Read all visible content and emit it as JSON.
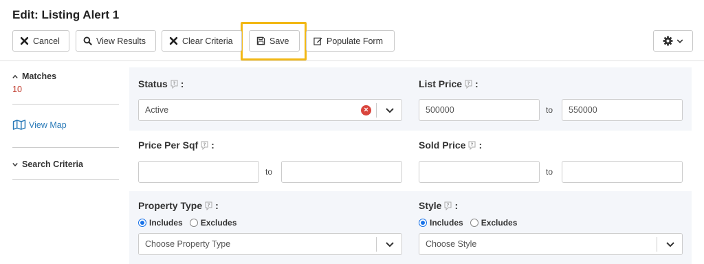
{
  "title": "Edit: Listing Alert 1",
  "toolbar": {
    "cancel": "Cancel",
    "view_results": "View Results",
    "clear_criteria": "Clear Criteria",
    "save": "Save",
    "populate_form": "Populate Form",
    "highlight_color": "#f2b815"
  },
  "sidebar": {
    "matches_label": "Matches",
    "matches_count": "10",
    "view_map": "View Map",
    "search_criteria": "Search Criteria"
  },
  "form": {
    "status": {
      "label": "Status",
      "value": "Active"
    },
    "list_price": {
      "label": "List Price",
      "from": "500000",
      "to_label": "to",
      "to": "550000"
    },
    "price_per_sqf": {
      "label": "Price Per Sqf",
      "from": "",
      "to_label": "to",
      "to": ""
    },
    "sold_price": {
      "label": "Sold Price",
      "from": "",
      "to_label": "to",
      "to": ""
    },
    "property_type": {
      "label": "Property Type",
      "includes": "Includes",
      "excludes": "Excludes",
      "placeholder": "Choose Property Type"
    },
    "style": {
      "label": "Style",
      "includes": "Includes",
      "excludes": "Excludes",
      "placeholder": "Choose Style"
    }
  }
}
